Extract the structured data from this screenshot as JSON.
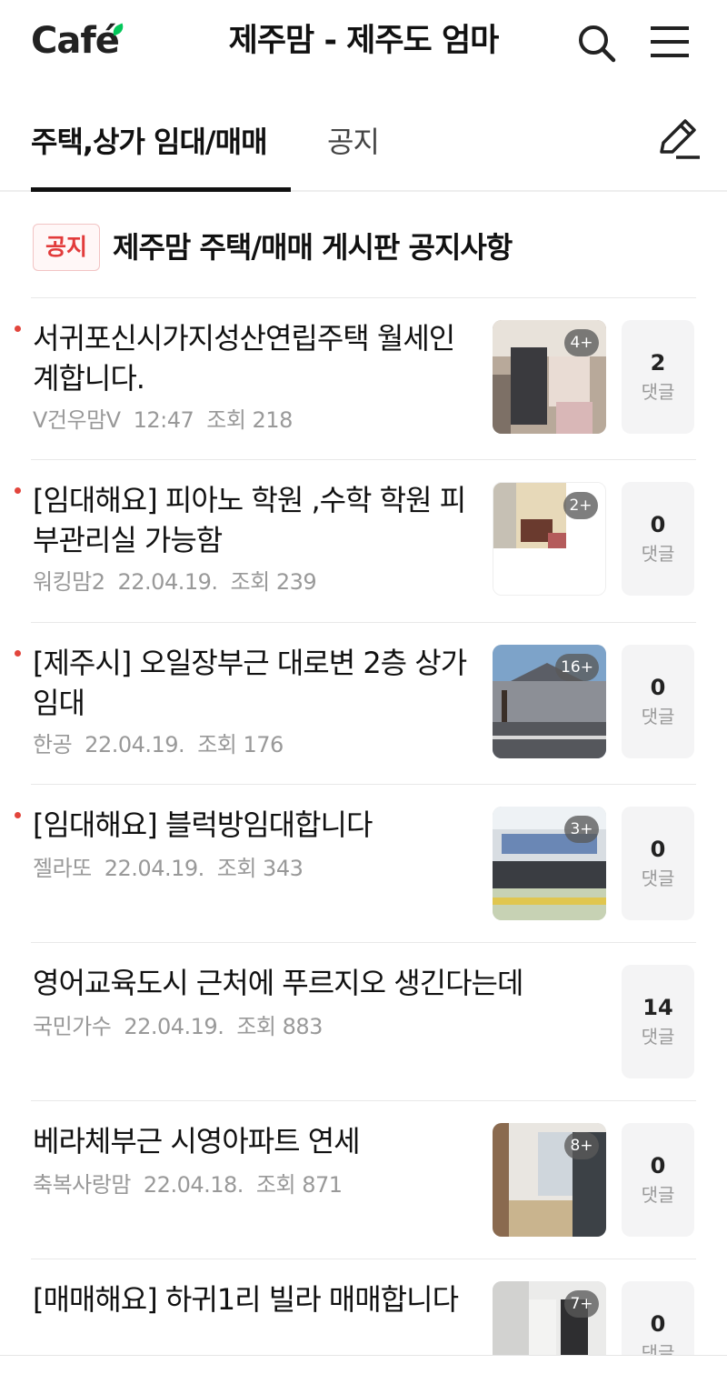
{
  "header": {
    "logo": "Café",
    "cafe_title": "제주맘 - 제주도 엄마",
    "search_icon": "search-icon",
    "menu_icon": "hamburger-menu-icon"
  },
  "tabs": [
    {
      "label": "주택,상가 임대/매매",
      "active": true
    },
    {
      "label": "공지",
      "active": false
    }
  ],
  "write_icon": "pencil-icon",
  "notice": {
    "badge": "공지",
    "title": "제주맘 주택/매매 게시판 공지사항"
  },
  "posts": [
    {
      "title": "서귀포신시가지성산연립주택 월세인계합니다.",
      "author": "V건우맘V",
      "time": "12:47",
      "views": "조회 218",
      "photo_count": "4+",
      "comments": "2",
      "comment_label": "댓글",
      "new": true
    },
    {
      "title": "[임대해요] 피아노 학원 ,수학 학원 피부관리실 가능함",
      "author": "워킹맘2",
      "time": "22.04.19.",
      "views": "조회 239",
      "photo_count": "2+",
      "comments": "0",
      "comment_label": "댓글",
      "new": true
    },
    {
      "title": "[제주시] 오일장부근 대로변 2층 상가 임대",
      "author": "한공",
      "time": "22.04.19.",
      "views": "조회 176",
      "photo_count": "16+",
      "comments": "0",
      "comment_label": "댓글",
      "new": true
    },
    {
      "title": "[임대해요] 블럭방임대합니다",
      "author": "젤라또",
      "time": "22.04.19.",
      "views": "조회 343",
      "photo_count": "3+",
      "comments": "0",
      "comment_label": "댓글",
      "new": true
    },
    {
      "title": "영어교육도시 근처에 푸르지오 생긴다는데",
      "author": "국민가수",
      "time": "22.04.19.",
      "views": "조회 883",
      "photo_count": "",
      "comments": "14",
      "comment_label": "댓글",
      "new": false
    },
    {
      "title": "베라체부근 시영아파트 연세",
      "author": "축복사랑맘",
      "time": "22.04.18.",
      "views": "조회 871",
      "photo_count": "8+",
      "comments": "0",
      "comment_label": "댓글",
      "new": false
    },
    {
      "title": "[매매해요] 하귀1리 빌라 매매합니다",
      "author": "",
      "time": "",
      "views": "",
      "photo_count": "7+",
      "comments": "0",
      "comment_label": "댓글",
      "new": false
    }
  ],
  "colors": {
    "accent_red": "#e2453c",
    "text_primary": "#111111",
    "text_meta": "#999999",
    "comment_bg": "#f4f4f5"
  }
}
